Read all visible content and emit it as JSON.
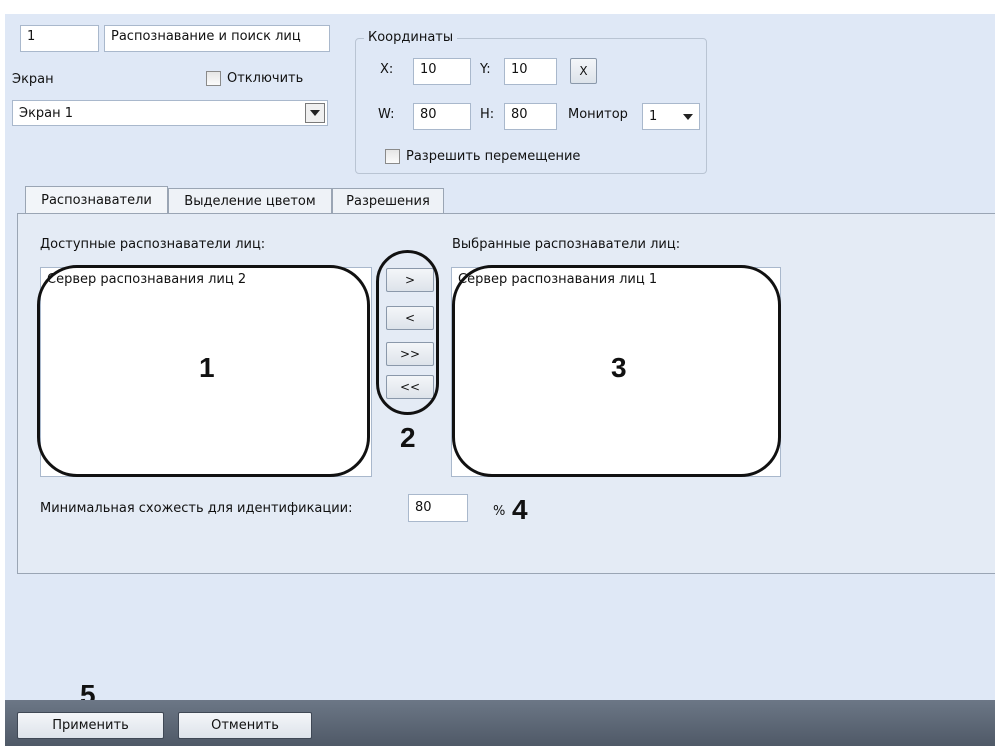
{
  "header": {
    "id_value": "1",
    "name_value": "Распознавание и поиск лиц",
    "screen_label": "Экран",
    "disable_label": "Отключить",
    "screen_select_value": "Экран 1"
  },
  "coords": {
    "group_title": "Координаты",
    "x_label": "X:",
    "x_value": "10",
    "y_label": "Y:",
    "y_value": "10",
    "clear_label": "X",
    "w_label": "W:",
    "w_value": "80",
    "h_label": "H:",
    "h_value": "80",
    "monitor_label": "Монитор",
    "monitor_value": "1",
    "allow_move_label": "Разрешить перемещение"
  },
  "tabs": [
    {
      "label": "Распознаватели"
    },
    {
      "label": "Выделение цветом"
    },
    {
      "label": "Разрешения"
    }
  ],
  "recognizers": {
    "available_title": "Доступные распознаватели лиц:",
    "available_items": [
      "Сервер распознавания лиц 2"
    ],
    "selected_title": "Выбранные распознаватели лиц:",
    "selected_items": [
      "Сервер распознавания лиц 1"
    ],
    "btn_add": ">",
    "btn_remove": "<",
    "btn_add_all": ">>",
    "btn_remove_all": "<<",
    "similarity_label": "Минимальная схожесть для идентификации:",
    "similarity_value": "80",
    "percent": "%"
  },
  "callouts": [
    "1",
    "2",
    "3",
    "4",
    "5"
  ],
  "footer": {
    "apply_label": "Применить",
    "cancel_label": "Отменить"
  }
}
